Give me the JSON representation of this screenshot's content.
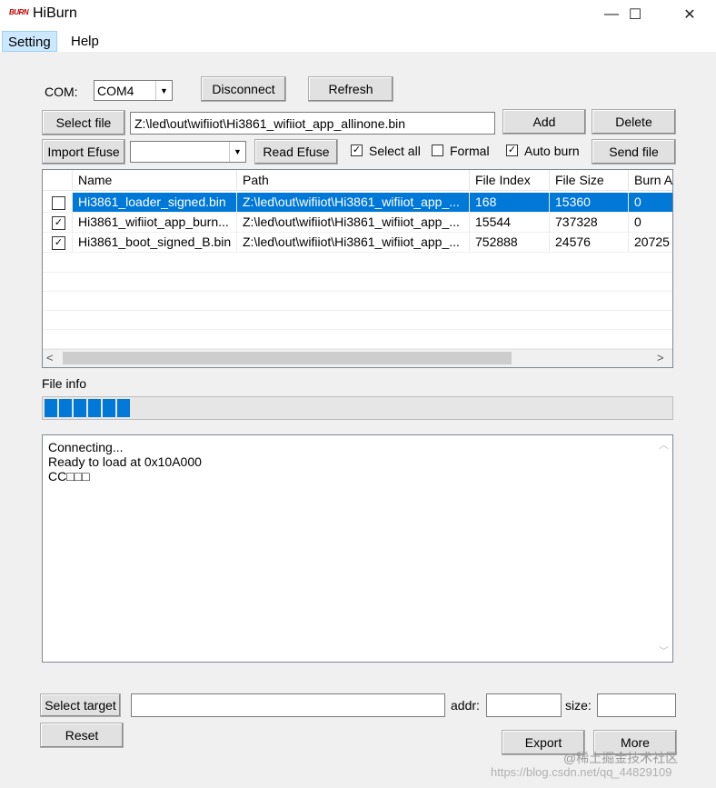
{
  "window": {
    "title": "HiBurn",
    "logo_text": "BURN",
    "minimize": "—",
    "maximize": "☐",
    "close": "✕"
  },
  "menu": [
    {
      "label": "Setting"
    },
    {
      "label": "Help"
    }
  ],
  "com": {
    "label": "COM:",
    "value": "COM4"
  },
  "buttons": {
    "disconnect": "Disconnect",
    "refresh": "Refresh",
    "select_file": "Select file",
    "add": "Add",
    "delete": "Delete",
    "import_efuse": "Import Efuse",
    "read_efuse": "Read Efuse",
    "send_file": "Send file",
    "select_target": "Select target",
    "reset": "Reset",
    "export": "Export",
    "more": "More"
  },
  "file_path": "Z:\\led\\out\\wifiiot\\Hi3861_wifiiot_app_allinone.bin",
  "efuse_value": "",
  "options": {
    "select_all": {
      "label": "Select all",
      "checked": true
    },
    "formal": {
      "label": "Formal",
      "checked": false
    },
    "auto_burn": {
      "label": "Auto burn",
      "checked": true
    }
  },
  "table": {
    "columns": [
      "Name",
      "Path",
      "File Index",
      "File Size",
      "Burn A"
    ],
    "rows": [
      {
        "checked": true,
        "name": "Hi3861_loader_signed.bin",
        "path": "Z:\\led\\out\\wifiiot\\Hi3861_wifiiot_app_...",
        "file_index": "168",
        "file_size": "15360",
        "burn_addr": "0"
      },
      {
        "checked": true,
        "name": "Hi3861_wifiiot_app_burn...",
        "path": "Z:\\led\\out\\wifiiot\\Hi3861_wifiiot_app_...",
        "file_index": "15544",
        "file_size": "737328",
        "burn_addr": "0"
      },
      {
        "checked": true,
        "name": "Hi3861_boot_signed_B.bin",
        "path": "Z:\\led\\out\\wifiiot\\Hi3861_wifiiot_app_...",
        "file_index": "752888",
        "file_size": "24576",
        "burn_addr": "20725"
      }
    ],
    "scroll_left": "<",
    "scroll_right": ">"
  },
  "file_info": {
    "label": "File info",
    "progress_blocks": 6
  },
  "log": {
    "lines": [
      "Connecting...",
      "Ready to load at 0x10A000",
      "CC□□□"
    ],
    "scroll_up": "︿",
    "scroll_down": "﹀"
  },
  "target": {
    "value": "",
    "addr_label": "addr:",
    "addr_value": "",
    "size_label": "size:",
    "size_value": ""
  },
  "watermark": {
    "line1": "@稀土掘金技术社区",
    "line2": "https://blog.csdn.net/qq_44829109"
  },
  "colors": {
    "selection": "#0078d7",
    "progress": "#0078d7"
  }
}
